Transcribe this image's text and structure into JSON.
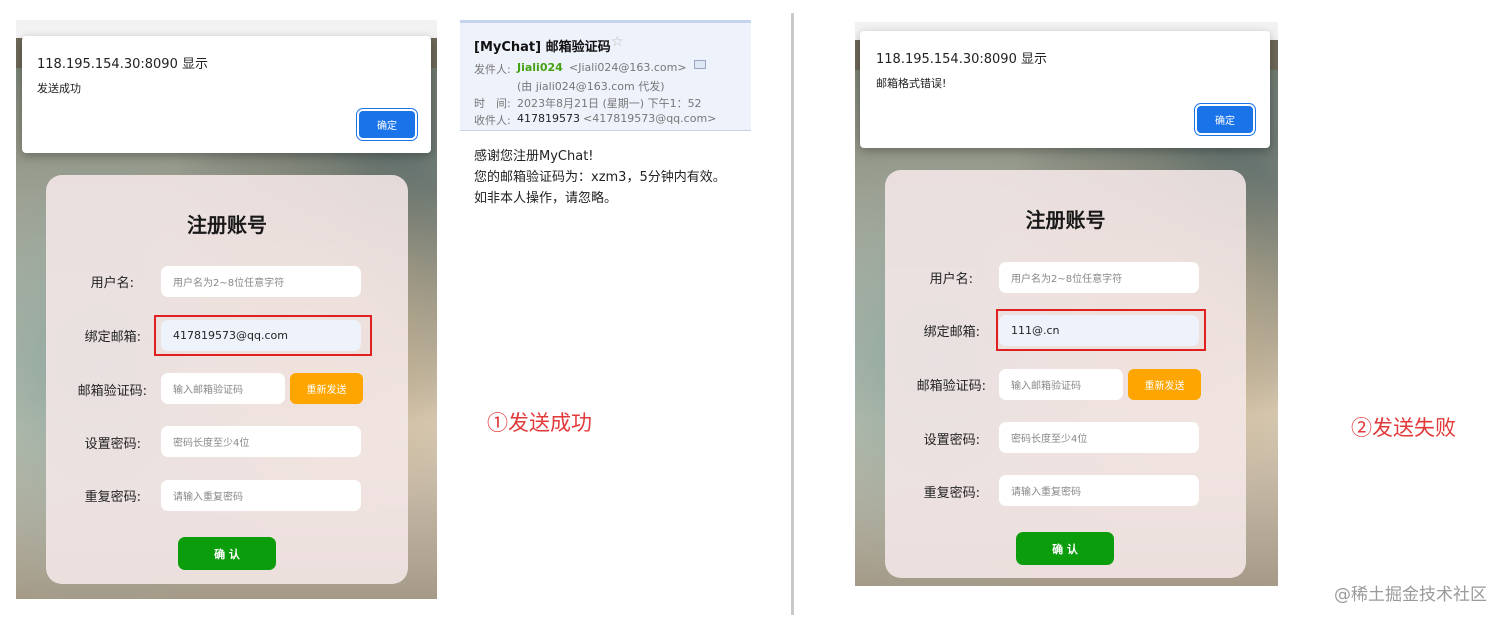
{
  "left_panel": {
    "dialog": {
      "title": "118.195.154.30:8090 显示",
      "message": "发送成功",
      "ok_label": "确定"
    },
    "form": {
      "title": "注册账号",
      "username_label": "用户名:",
      "username_placeholder": "用户名为2~8位任意字符",
      "email_label": "绑定邮箱:",
      "email_value": "417819573@qq.com",
      "code_label": "邮箱验证码:",
      "code_placeholder": "输入邮箱验证码",
      "resend_label": "重新发送",
      "password_label": "设置密码:",
      "password_placeholder": "密码长度至少4位",
      "repeat_label": "重复密码:",
      "repeat_placeholder": "请输入重复密码",
      "confirm_label": "确 认"
    }
  },
  "email": {
    "subject": "[MyChat] 邮箱验证码",
    "from_label": "发件人:",
    "from_name": "Jiali024",
    "from_address": "<Jiali024@163.com>",
    "on_behalf": "(由 jiali024@163.com 代发)",
    "time_label": "时　间:",
    "time_value": "2023年8月21日 (星期一) 下午1：52",
    "to_label": "收件人:",
    "to_name": "417819573",
    "to_address": "<417819573@qq.com>",
    "body_line1": "感谢您注册MyChat!",
    "body_line2": "您的邮箱验证码为：xzm3，5分钟内有效。",
    "body_line3": "如非本人操作，请忽略。"
  },
  "caption_success": "①发送成功",
  "right_panel": {
    "dialog": {
      "title": "118.195.154.30:8090 显示",
      "message": "邮箱格式错误!",
      "ok_label": "确定"
    },
    "form": {
      "title": "注册账号",
      "username_label": "用户名:",
      "username_placeholder": "用户名为2~8位任意字符",
      "email_label": "绑定邮箱:",
      "email_value": "111@.cn",
      "code_label": "邮箱验证码:",
      "code_placeholder": "输入邮箱验证码",
      "resend_label": "重新发送",
      "password_label": "设置密码:",
      "password_placeholder": "密码长度至少4位",
      "repeat_label": "重复密码:",
      "repeat_placeholder": "请输入重复密码",
      "confirm_label": "确 认"
    }
  },
  "caption_failure": "②发送失败",
  "watermark": "@稀土掘金技术社区",
  "colors": {
    "highlight": "#e02020",
    "resend": "#ffa500",
    "confirm": "#0c9d0c",
    "dialog_ok": "#1a73e8",
    "caption": "#e23a3a"
  }
}
